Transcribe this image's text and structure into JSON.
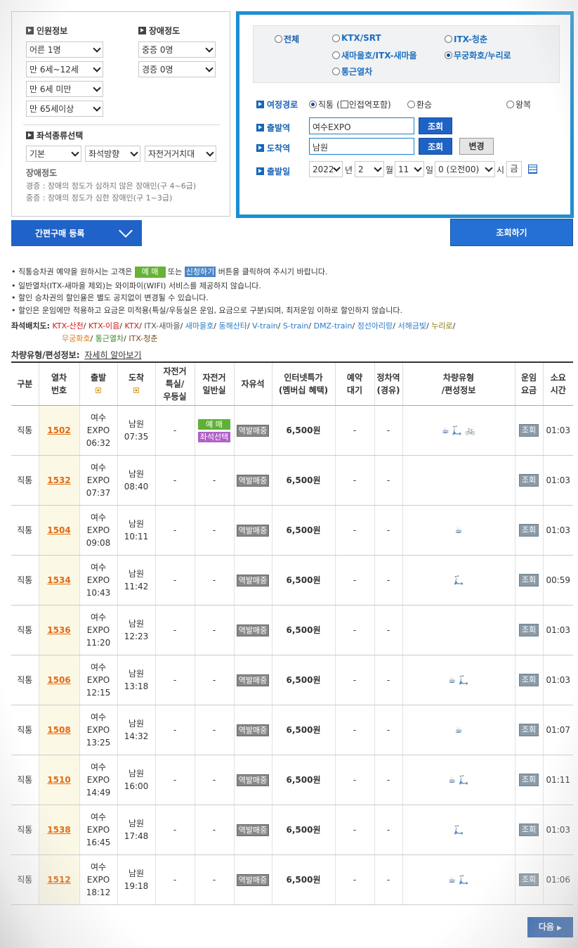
{
  "passenger": {
    "title": "인원정보",
    "selects": [
      "어른 1명",
      "만 6세~12세",
      "만 6세 미만",
      "만 65세이상"
    ]
  },
  "disability": {
    "title": "장애정도",
    "selects": [
      "중증 0명",
      "경증 0명"
    ]
  },
  "seat_type": {
    "title": "좌석종류선택",
    "selects": [
      "기본",
      "좌석방향",
      "자전거거치대"
    ]
  },
  "disability_note": {
    "title": "장애정도",
    "line1": "경증 : 장애의 정도가 심하지 않은 장애인(구 4~6급)",
    "line2": "중증 : 장애의 정도가 심한 장애인(구 1~3급)"
  },
  "train_types": [
    {
      "label": "전체",
      "selected": false
    },
    {
      "label": "KTX/SRT",
      "selected": false
    },
    {
      "label": "ITX-청춘",
      "selected": false
    },
    {
      "label": "새마을호/ITX-새마을",
      "selected": false
    },
    {
      "label": "무궁화호/누리로",
      "selected": true
    },
    {
      "label": "통근열차",
      "selected": false
    }
  ],
  "route": {
    "label": "여정경로",
    "direct": "직통",
    "adjacent": "(",
    "adjacent_label": "인접역포함)",
    "transfer": "환승",
    "round": "왕복"
  },
  "departure": {
    "label": "출발역",
    "value": "여수EXPO",
    "button": "조회"
  },
  "arrival": {
    "label": "도착역",
    "value": "남원",
    "button": "조회",
    "change": "변경"
  },
  "date": {
    "label": "출발일",
    "year": "2022",
    "year_unit": "년",
    "month": "2",
    "month_unit": "월",
    "day": "11",
    "day_unit": "일",
    "hour": "0 (오전00)",
    "hour_unit": "시",
    "weekday": "금"
  },
  "quick_buy": "간편구매 등록",
  "search_button": "조회하기",
  "notices": {
    "n1_a": "직통승차권 예약을 원하시는 고객은",
    "n1_book": "예 매",
    "n1_or": "또는",
    "n1_apply": "신청하기",
    "n1_b": "버튼을 클릭하여 주시기 바랍니다.",
    "n2": "일반열차(ITX-새마을 제외)는 와이파이(WIFI) 서비스를 제공하지 않습니다.",
    "n3": "할인 승차권의 할인율은 별도 공지없이 변경될 수 있습니다.",
    "n4": "할인은 운임에만 적용하고 요금은 미적용(특실/우등실은 운임, 요금으로 구분)되며, 최저운임 이하로 할인하지 않습니다."
  },
  "seat_layout": {
    "label": "좌석배치도:",
    "links1": [
      {
        "text": "KTX-산천",
        "color": "#d21818"
      },
      {
        "text": "KTX-이음",
        "color": "#d21818"
      },
      {
        "text": "KTX",
        "color": "#d21818"
      },
      {
        "text": "ITX-새마을",
        "color": "#555555"
      },
      {
        "text": "새마을호",
        "color": "#2a7bc8"
      },
      {
        "text": "동해산타",
        "color": "#2a7bc8"
      },
      {
        "text": "V-train",
        "color": "#2a7bc8"
      },
      {
        "text": "S-train",
        "color": "#2a7bc8"
      },
      {
        "text": "DMZ-train",
        "color": "#2a7bc8"
      },
      {
        "text": "정선아리랑",
        "color": "#2a7bc8"
      },
      {
        "text": "서해금빛",
        "color": "#2a7bc8"
      },
      {
        "text": "누리로",
        "color": "#8a7a10"
      }
    ],
    "links2": [
      {
        "text": "무궁화호",
        "color": "#e07a12"
      },
      {
        "text": "통근열차",
        "color": "#3a8a28"
      },
      {
        "text": "ITX-청춘",
        "color": "#7a4a18"
      }
    ]
  },
  "car_info": {
    "label": "차량유형/편성정보:",
    "link": "자세히 알아보기"
  },
  "table": {
    "headers": [
      "구분",
      "열차\n번호",
      "출발",
      "도착",
      "자전거\n특실/\n우등실",
      "자전거\n일반실",
      "자유석",
      "인터넷특가\n(멤버십 혜택)",
      "예약\n대기",
      "정차역\n(경유)",
      "차량유형\n/편성정보",
      "운임\n요금",
      "소요\n시간"
    ],
    "rows": [
      {
        "type": "직통",
        "no": "1502",
        "dep1": "여수",
        "dep2": "EXPO",
        "dep_time": "06:32",
        "arr": "남원",
        "arr_time": "07:35",
        "bike_first": "-",
        "bike_general": "",
        "free": "역발매중",
        "price": "6,500원",
        "wait": "-",
        "stops": "-",
        "icons": "☕ 🛴 🚲",
        "fare": "조회",
        "duration": "01:03",
        "book": "예 매",
        "seat": "좌석선택"
      },
      {
        "type": "직통",
        "no": "1532",
        "dep1": "여수",
        "dep2": "EXPO",
        "dep_time": "07:37",
        "arr": "남원",
        "arr_time": "08:40",
        "bike_first": "-",
        "bike_general": "-",
        "free": "역발매중",
        "price": "6,500원",
        "wait": "-",
        "stops": "-",
        "icons": "",
        "fare": "조회",
        "duration": "01:03"
      },
      {
        "type": "직통",
        "no": "1504",
        "dep1": "여수",
        "dep2": "EXPO",
        "dep_time": "09:08",
        "arr": "남원",
        "arr_time": "10:11",
        "bike_first": "-",
        "bike_general": "-",
        "free": "역발매중",
        "price": "6,500원",
        "wait": "-",
        "stops": "-",
        "icons": "☕",
        "fare": "조회",
        "duration": "01:03"
      },
      {
        "type": "직통",
        "no": "1534",
        "dep1": "여수",
        "dep2": "EXPO",
        "dep_time": "10:43",
        "arr": "남원",
        "arr_time": "11:42",
        "bike_first": "-",
        "bike_general": "-",
        "free": "역발매중",
        "price": "6,500원",
        "wait": "-",
        "stops": "-",
        "icons": "🛴",
        "fare": "조회",
        "duration": "00:59"
      },
      {
        "type": "직통",
        "no": "1536",
        "dep1": "여수",
        "dep2": "EXPO",
        "dep_time": "11:20",
        "arr": "남원",
        "arr_time": "12:23",
        "bike_first": "-",
        "bike_general": "-",
        "free": "역발매중",
        "price": "6,500원",
        "wait": "-",
        "stops": "-",
        "icons": "",
        "fare": "조회",
        "duration": "01:03"
      },
      {
        "type": "직통",
        "no": "1506",
        "dep1": "여수",
        "dep2": "EXPO",
        "dep_time": "12:15",
        "arr": "남원",
        "arr_time": "13:18",
        "bike_first": "-",
        "bike_general": "-",
        "free": "역발매중",
        "price": "6,500원",
        "wait": "-",
        "stops": "-",
        "icons": "☕ 🛴",
        "fare": "조회",
        "duration": "01:03"
      },
      {
        "type": "직통",
        "no": "1508",
        "dep1": "여수",
        "dep2": "EXPO",
        "dep_time": "13:25",
        "arr": "남원",
        "arr_time": "14:32",
        "bike_first": "-",
        "bike_general": "-",
        "free": "역발매중",
        "price": "6,500원",
        "wait": "-",
        "stops": "-",
        "icons": "☕",
        "fare": "조회",
        "duration": "01:07"
      },
      {
        "type": "직통",
        "no": "1510",
        "dep1": "여수",
        "dep2": "EXPO",
        "dep_time": "14:49",
        "arr": "남원",
        "arr_time": "16:00",
        "bike_first": "-",
        "bike_general": "-",
        "free": "역발매중",
        "price": "6,500원",
        "wait": "-",
        "stops": "-",
        "icons": "☕ 🛴",
        "fare": "조회",
        "duration": "01:11"
      },
      {
        "type": "직통",
        "no": "1538",
        "dep1": "여수",
        "dep2": "EXPO",
        "dep_time": "16:45",
        "arr": "남원",
        "arr_time": "17:48",
        "bike_first": "-",
        "bike_general": "-",
        "free": "역발매중",
        "price": "6,500원",
        "wait": "-",
        "stops": "-",
        "icons": "🛴",
        "fare": "조회",
        "duration": "01:03"
      },
      {
        "type": "직통",
        "no": "1512",
        "dep1": "여수",
        "dep2": "EXPO",
        "dep_time": "18:12",
        "arr": "남원",
        "arr_time": "19:18",
        "bike_first": "-",
        "bike_general": "-",
        "free": "역발매중",
        "price": "6,500원",
        "wait": "-",
        "stops": "-",
        "icons": "☕ 🛴",
        "fare": "조회",
        "duration": "01:06"
      }
    ]
  },
  "next_button": "다음"
}
